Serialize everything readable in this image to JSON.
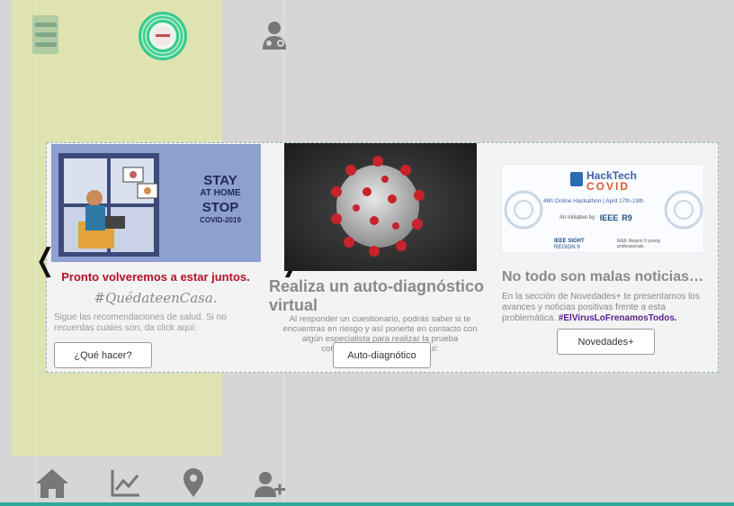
{
  "colors": {
    "accent": "#2ea89a",
    "highlight": "#b3122a",
    "hashtag2": "#5b1e8f"
  },
  "topbar": {
    "menu_icon": "hamburger-icon",
    "logo_icon": "logo-icon",
    "doctor_icon": "doctor-icon"
  },
  "carousel": {
    "prev": "❬",
    "next": "❭",
    "slides": [
      {
        "image_text": {
          "line1": "STAY",
          "line2": "AT HOME",
          "line3": "STOP",
          "line4": "COVID-2019"
        },
        "title": "Pronto volveremos a estar juntos.",
        "hashtag": "#QuédateenCasa.",
        "description": "Sigue las recomendaciones de salud. Si no recuerdas cuales son, da click aquí:",
        "button": "¿Qué hacer?"
      },
      {
        "title": "Realiza un auto-diagnóstico virtual",
        "description": "Al responder un cuestionario, podrás saber si te encuentras en riesgo y así ponerte en contacto con algún especialista para realizar la prueba correspondiente. Da click aquí:",
        "button": "Auto-diagnótico"
      },
      {
        "image_text": {
          "brand": "HackTech",
          "brand2": "COVID",
          "sub": "48h Online Hackathon | April 17th-19th",
          "initiative": "An Initiative by:",
          "ieee": "IEEE",
          "r9": "R9",
          "sight": "IEEE SIGHT",
          "region": "REGION 9",
          "yp": "IEEE Region 9 young professionals"
        },
        "title": "No todo son malas noticias…",
        "description": "En la sección de Novedades+ te presentamos los avances y noticias positivas frente a esta problemática.",
        "hashtag": "#ElVirusLoFrenamosTodos.",
        "button": "Novedades+"
      }
    ]
  },
  "bottom_nav": [
    {
      "icon": "home-icon"
    },
    {
      "icon": "chart-icon"
    },
    {
      "icon": "location-icon"
    },
    {
      "icon": "add-user-icon"
    }
  ]
}
